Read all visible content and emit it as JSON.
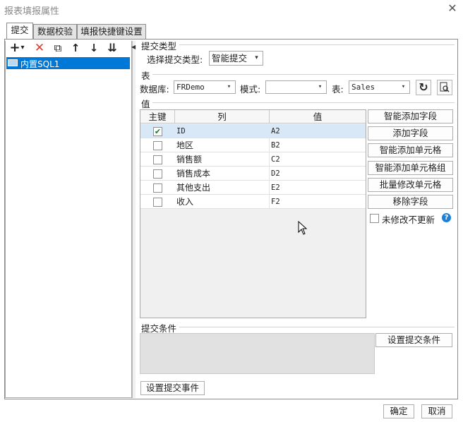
{
  "window": {
    "title": "报表填报属性",
    "close_icon": "close-icon"
  },
  "tabs": [
    {
      "label": "提交"
    },
    {
      "label": "数据校验"
    },
    {
      "label": "填报快捷键设置"
    }
  ],
  "left_toolbar": {
    "add": "+",
    "add_dropdown": "▾",
    "delete": "✕",
    "copy": "⧉",
    "up": "↑",
    "down": "↓",
    "sort": "⇊"
  },
  "tree": {
    "items": [
      {
        "label": "内置SQL1"
      }
    ]
  },
  "submit_type": {
    "section": "提交类型",
    "label": "选择提交类型:",
    "value": "智能提交"
  },
  "table_section": {
    "section": "表",
    "db_label": "数据库:",
    "db_value": "FRDemo",
    "mode_label": "模式:",
    "mode_value": "",
    "table_label": "表:",
    "table_value": "Sales"
  },
  "values_section": {
    "section": "值",
    "columns": {
      "key": "主键",
      "col": "列",
      "val": "值"
    },
    "rows": [
      {
        "key": true,
        "col": "ID",
        "val": "A2"
      },
      {
        "key": false,
        "col": "地区",
        "val": "B2"
      },
      {
        "key": false,
        "col": "销售额",
        "val": "C2"
      },
      {
        "key": false,
        "col": "销售成本",
        "val": "D2"
      },
      {
        "key": false,
        "col": "其他支出",
        "val": "E2"
      },
      {
        "key": false,
        "col": "收入",
        "val": "F2"
      }
    ]
  },
  "side_buttons": {
    "smart_add_field": "智能添加字段",
    "add_field": "添加字段",
    "smart_add_cell": "智能添加单元格",
    "smart_add_cell_group": "智能添加单元格组",
    "batch_modify_cell": "批量修改单元格",
    "remove_field": "移除字段",
    "no_update_label": "未修改不更新",
    "help_glyph": "?"
  },
  "submit_condition": {
    "section": "提交条件",
    "set_button": "设置提交条件"
  },
  "submit_event_button": "设置提交事件",
  "footer": {
    "ok": "确定",
    "cancel": "取消"
  },
  "colors": {
    "selection": "#0078d7",
    "delete_icon": "#e23b2e",
    "help_icon": "#1e7fd6"
  }
}
